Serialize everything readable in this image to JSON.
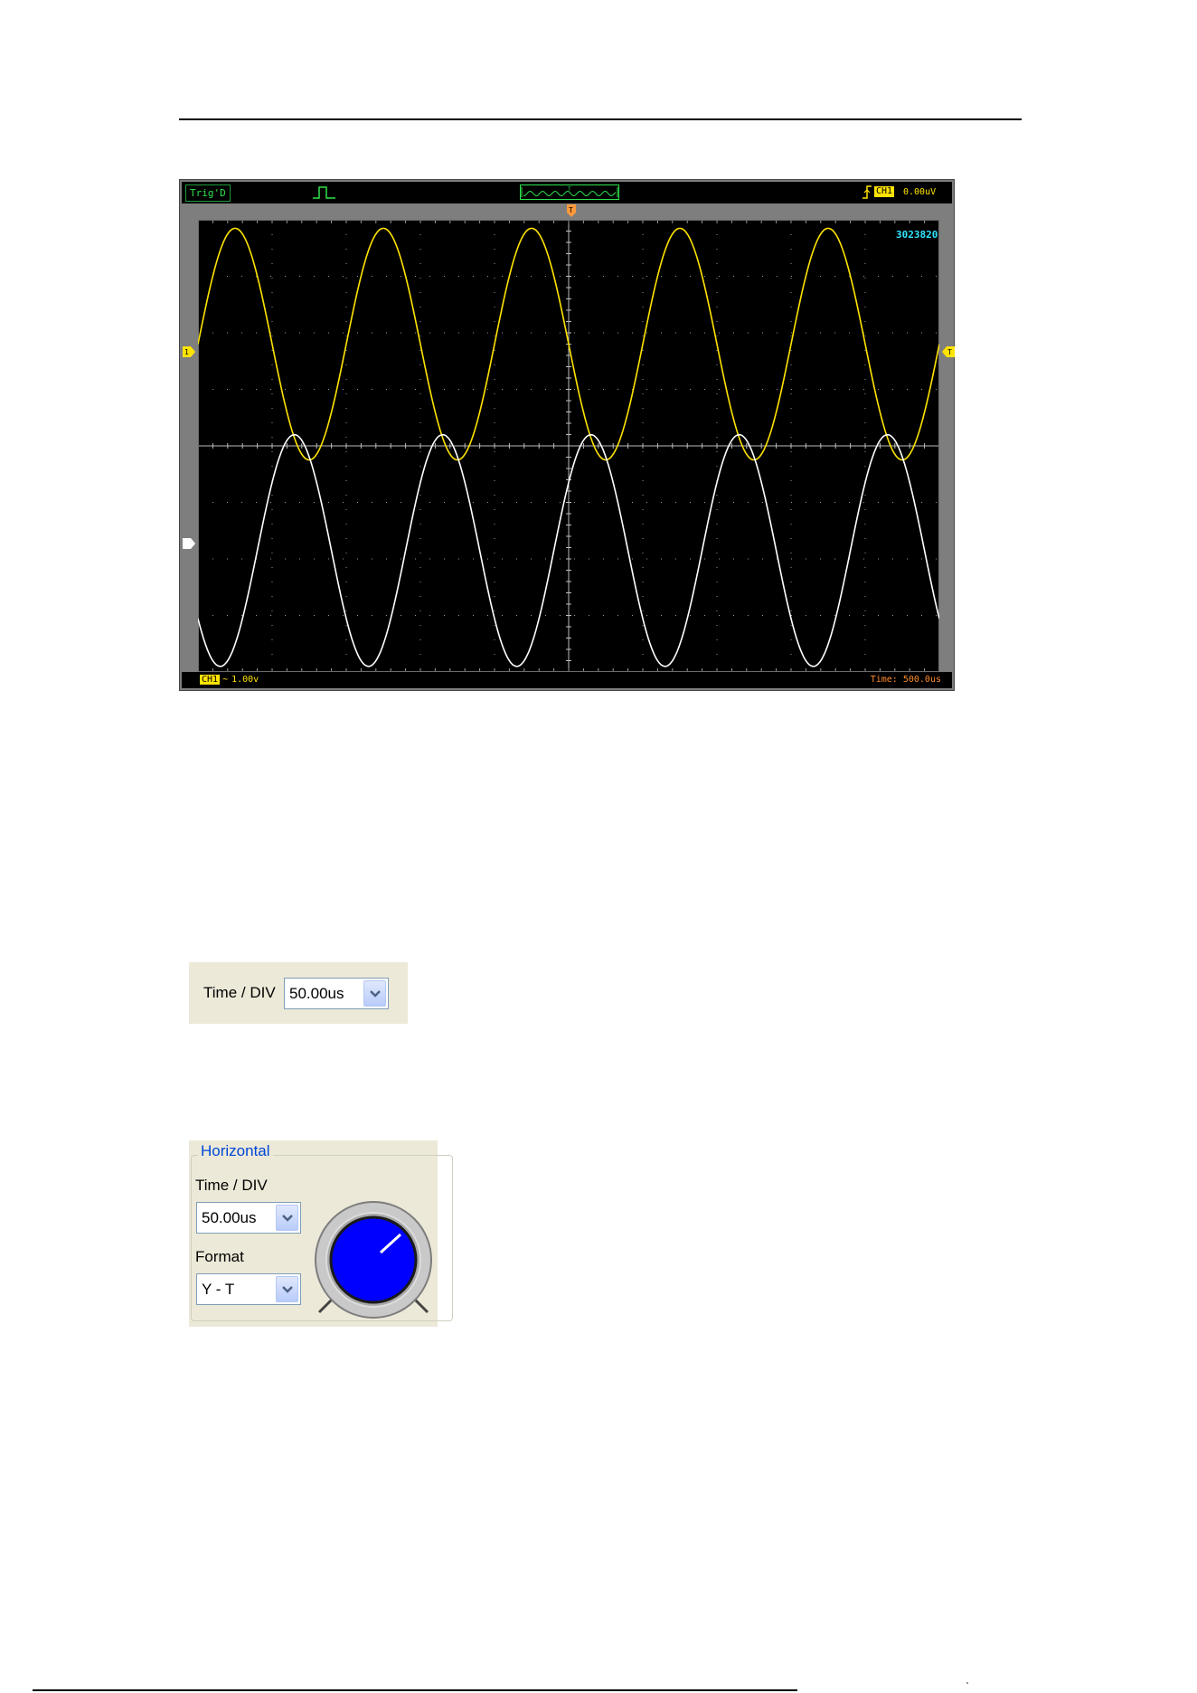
{
  "scope": {
    "trigger_status": "Trig'D",
    "frequency_counter": "3023820",
    "trigger_marker": "T",
    "ch1_marker": "1",
    "top_ch1_badge": "CH1",
    "trigger_level": "0.00uV",
    "bottom_ch1_badge": "CH1",
    "ch1_coupling_symbol": "~",
    "ch1_volts_div": "1.00v",
    "time_base": "Time: 500.0us",
    "colors": {
      "ch1_trace": "#ffe400",
      "ref_trace": "#ffffff",
      "counter": "#31e6ff",
      "trigger_status": "#2fe34e",
      "time_base": "#ff8a2a"
    },
    "traces": {
      "ch1_cycles_on_screen": 5,
      "ref_cycles_on_screen": 5,
      "ch1_amplitude_div": 2.05,
      "ref_amplitude_div": 2.05
    }
  },
  "timediv_toolbar": {
    "label": "Time / DIV",
    "value": "50.00us"
  },
  "horizontal_group": {
    "title": "Horizontal",
    "timediv_label": "Time / DIV",
    "timediv_value": "50.00us",
    "format_label": "Format",
    "format_value": "Y - T",
    "knob_color": "#0000ff"
  },
  "footer": {
    "corner_mark": "ˋ"
  }
}
